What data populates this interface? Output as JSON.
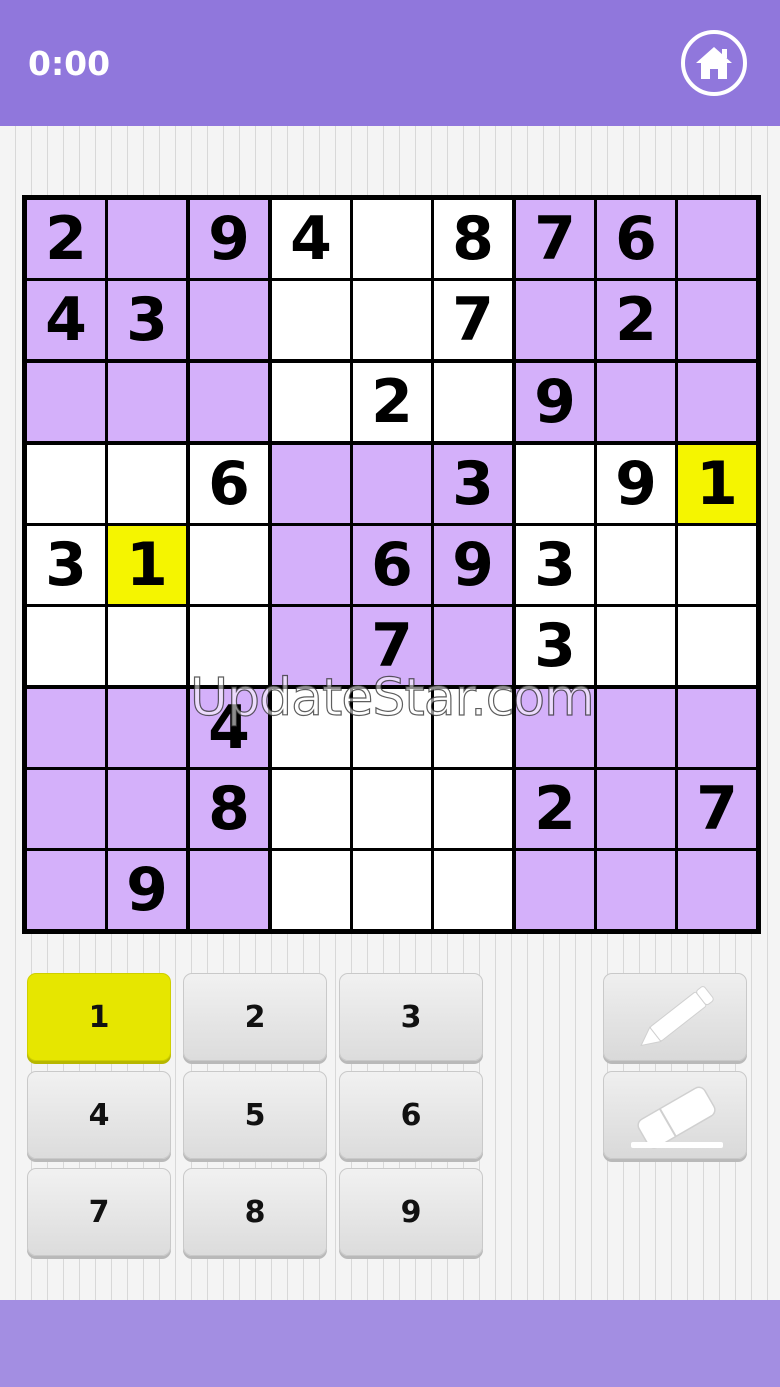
{
  "header": {
    "timer": "0:00",
    "home_icon": "home-icon"
  },
  "board": {
    "rows": [
      [
        "2",
        "",
        "9",
        "4",
        "",
        "8",
        "7",
        "6",
        ""
      ],
      [
        "4",
        "3",
        "",
        "",
        "",
        "7",
        "",
        "2",
        ""
      ],
      [
        "",
        "",
        "",
        "",
        "2",
        "",
        "9",
        "",
        ""
      ],
      [
        "",
        "",
        "6",
        "",
        "",
        "3",
        "",
        "9",
        "1"
      ],
      [
        "3",
        "1",
        "",
        "",
        "6",
        "9",
        "3",
        "",
        ""
      ],
      [
        "",
        "",
        "",
        "",
        "7",
        "",
        "3",
        "",
        ""
      ],
      [
        "",
        "",
        "4",
        "",
        "",
        "",
        "",
        "",
        ""
      ],
      [
        "",
        "",
        "8",
        "",
        "",
        "",
        "2",
        "",
        "7"
      ],
      [
        "",
        "9",
        "",
        "",
        "",
        "",
        "",
        "",
        ""
      ]
    ],
    "highlighted": [
      [
        3,
        8
      ],
      [
        4,
        1
      ]
    ],
    "colors": {
      "violet_box": "#d4b0fa",
      "white_box": "#ffffff",
      "highlight": "#f5f500"
    }
  },
  "watermark": "UpdateStar.com",
  "keypad": {
    "numbers": [
      "1",
      "2",
      "3",
      "4",
      "5",
      "6",
      "7",
      "8",
      "9"
    ],
    "selected": "1",
    "pencil_icon": "pencil-icon",
    "eraser_icon": "eraser-icon"
  },
  "theme": {
    "header_color": "#9077dc",
    "footer_color": "#a38ee2"
  }
}
